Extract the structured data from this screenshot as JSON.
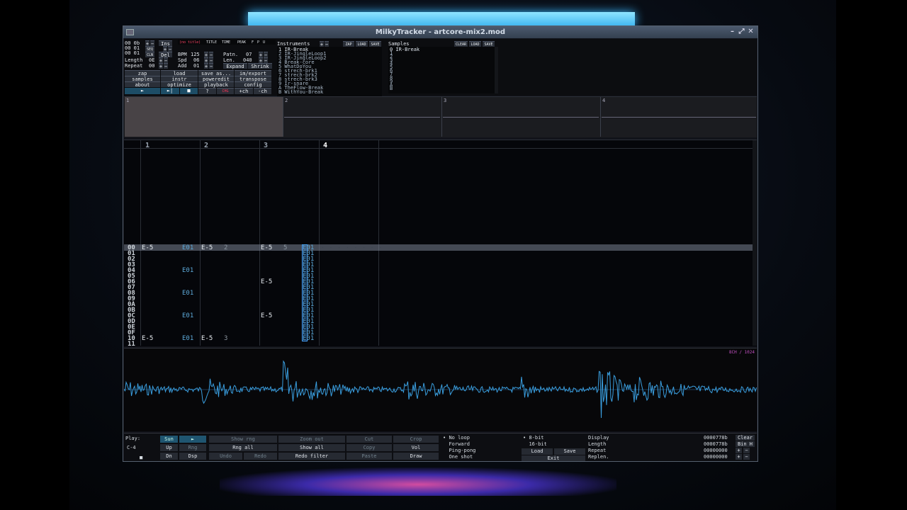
{
  "window": {
    "title": "MilkyTracker - artcore-mix2.mod"
  },
  "controls": {
    "pos_rows": [
      "00 0b",
      "00 01",
      "00 01"
    ],
    "ins_label": "Ins",
    "del_label": "Del",
    "length_label": "Length",
    "length_val": "0E",
    "repeat_label": "Repeat",
    "repeat_val": "00",
    "seq_label": "SEQ",
    "cln_label": "CLN",
    "bpm_label": "BPM",
    "bpm_val": "125",
    "spd_label": "Spd",
    "spd_val": "06",
    "add_label": "Add",
    "add_val": "01",
    "patn_label": "Patn.",
    "patn_val": "07",
    "len_label": "Len.",
    "len_val": "040",
    "expand_label": "Expand",
    "shrink_label": "Shrink",
    "tabs": [
      "TITLE",
      "TIME",
      "PEAK",
      "F",
      "P",
      "U"
    ],
    "title_field": "(no title)"
  },
  "menu": [
    [
      "zap",
      "load",
      "save as...",
      "im/export"
    ],
    [
      "samples",
      "instr",
      "poweredit",
      "transpose"
    ],
    [
      "about",
      "optimize",
      "playback",
      "config"
    ]
  ],
  "play_row": [
    "►",
    "►|",
    "■",
    "?",
    "CHG",
    "+ch",
    "-ch"
  ],
  "instruments": {
    "header": "Instruments",
    "zap": "ZAP",
    "load": "LOAD",
    "save": "SAVE",
    "items": [
      "1 IR-Break",
      "2 IR-JingleLoop1",
      "3 IR-JingleLoop2",
      "4 Break-core",
      "5 WhatDoYou",
      "6 strech-brk1",
      "7 strech-brk2",
      "8 strech-brk3",
      "9 Ir-snare",
      "A TheFlow-Break",
      "B WithYou-Break"
    ]
  },
  "samples": {
    "header": "Samples",
    "clear": "CLEAR",
    "load": "LOAD",
    "save": "SAVE",
    "items": [
      "0 IR-Break",
      "1",
      "2",
      "3",
      "4",
      "5",
      "6",
      "7",
      "8",
      "9",
      "A",
      "B"
    ]
  },
  "scopes": [
    "1",
    "2",
    "3",
    "4"
  ],
  "pattern": {
    "channels": [
      "1",
      "2",
      "3",
      "4"
    ],
    "rows": [
      "00",
      "01",
      "02",
      "03",
      "04",
      "05",
      "06",
      "07",
      "08",
      "09",
      "0A",
      "0B",
      "0C",
      "0D",
      "0E",
      "0F",
      "10",
      "11"
    ],
    "row_cur": "00",
    "r00": {
      "c1n": "E-5",
      "c1fx": "E01",
      "c2n": "E-5",
      "c2i": "2",
      "c3n": "E-5",
      "c3i": "5",
      "c4fx": "E01"
    },
    "r04": {
      "c1fx": "E01",
      "c4fx": "E01"
    },
    "r06": {
      "c3n": "E-5",
      "c4fx": "E01"
    },
    "r08": {
      "c1fx": "E01",
      "c4fx": "E01"
    },
    "r0C": {
      "c1fx": "E01",
      "c3n": "E-5",
      "c4fx": "E01"
    },
    "r10": {
      "c1n": "E-5",
      "c1fx": "E01",
      "c2n": "E-5",
      "c2i": "3",
      "c4fx": "E01"
    },
    "dots": "· · ·  · · · · ·",
    "fxcol": "E01"
  },
  "sample_tag": "8CH / 1024",
  "bottom": {
    "play_label": "Play:",
    "note": "C-4",
    "stop": "■",
    "sun": "Sun",
    "play": "►",
    "up": "Up",
    "rng": "Rng",
    "dn": "Dn",
    "dsp": "Dsp",
    "show_rng": "Show rng",
    "rng_all": "Rng all",
    "undo": "Undo",
    "redo": "Redo",
    "zoom_out": "Zoom out",
    "show_all": "Show all",
    "redo_filter": "Redo filter",
    "cut": "Cut",
    "copy": "Copy",
    "paste": "Paste",
    "crop": "Crop",
    "vol": "Vol",
    "draw": "Draw",
    "loops": [
      "No loop",
      "Forward",
      "Ping-pong",
      "One shot"
    ],
    "bits": [
      "8-bit",
      "16-bit"
    ],
    "load": "Load",
    "save": "Save",
    "exit": "Exit",
    "labels": [
      "Display",
      "Length",
      "Repeat",
      "Replen."
    ],
    "vals": [
      "0000778b",
      "0000778b",
      "00000000",
      "00000000"
    ],
    "clear": "Clear",
    "binh": "Bin H"
  }
}
